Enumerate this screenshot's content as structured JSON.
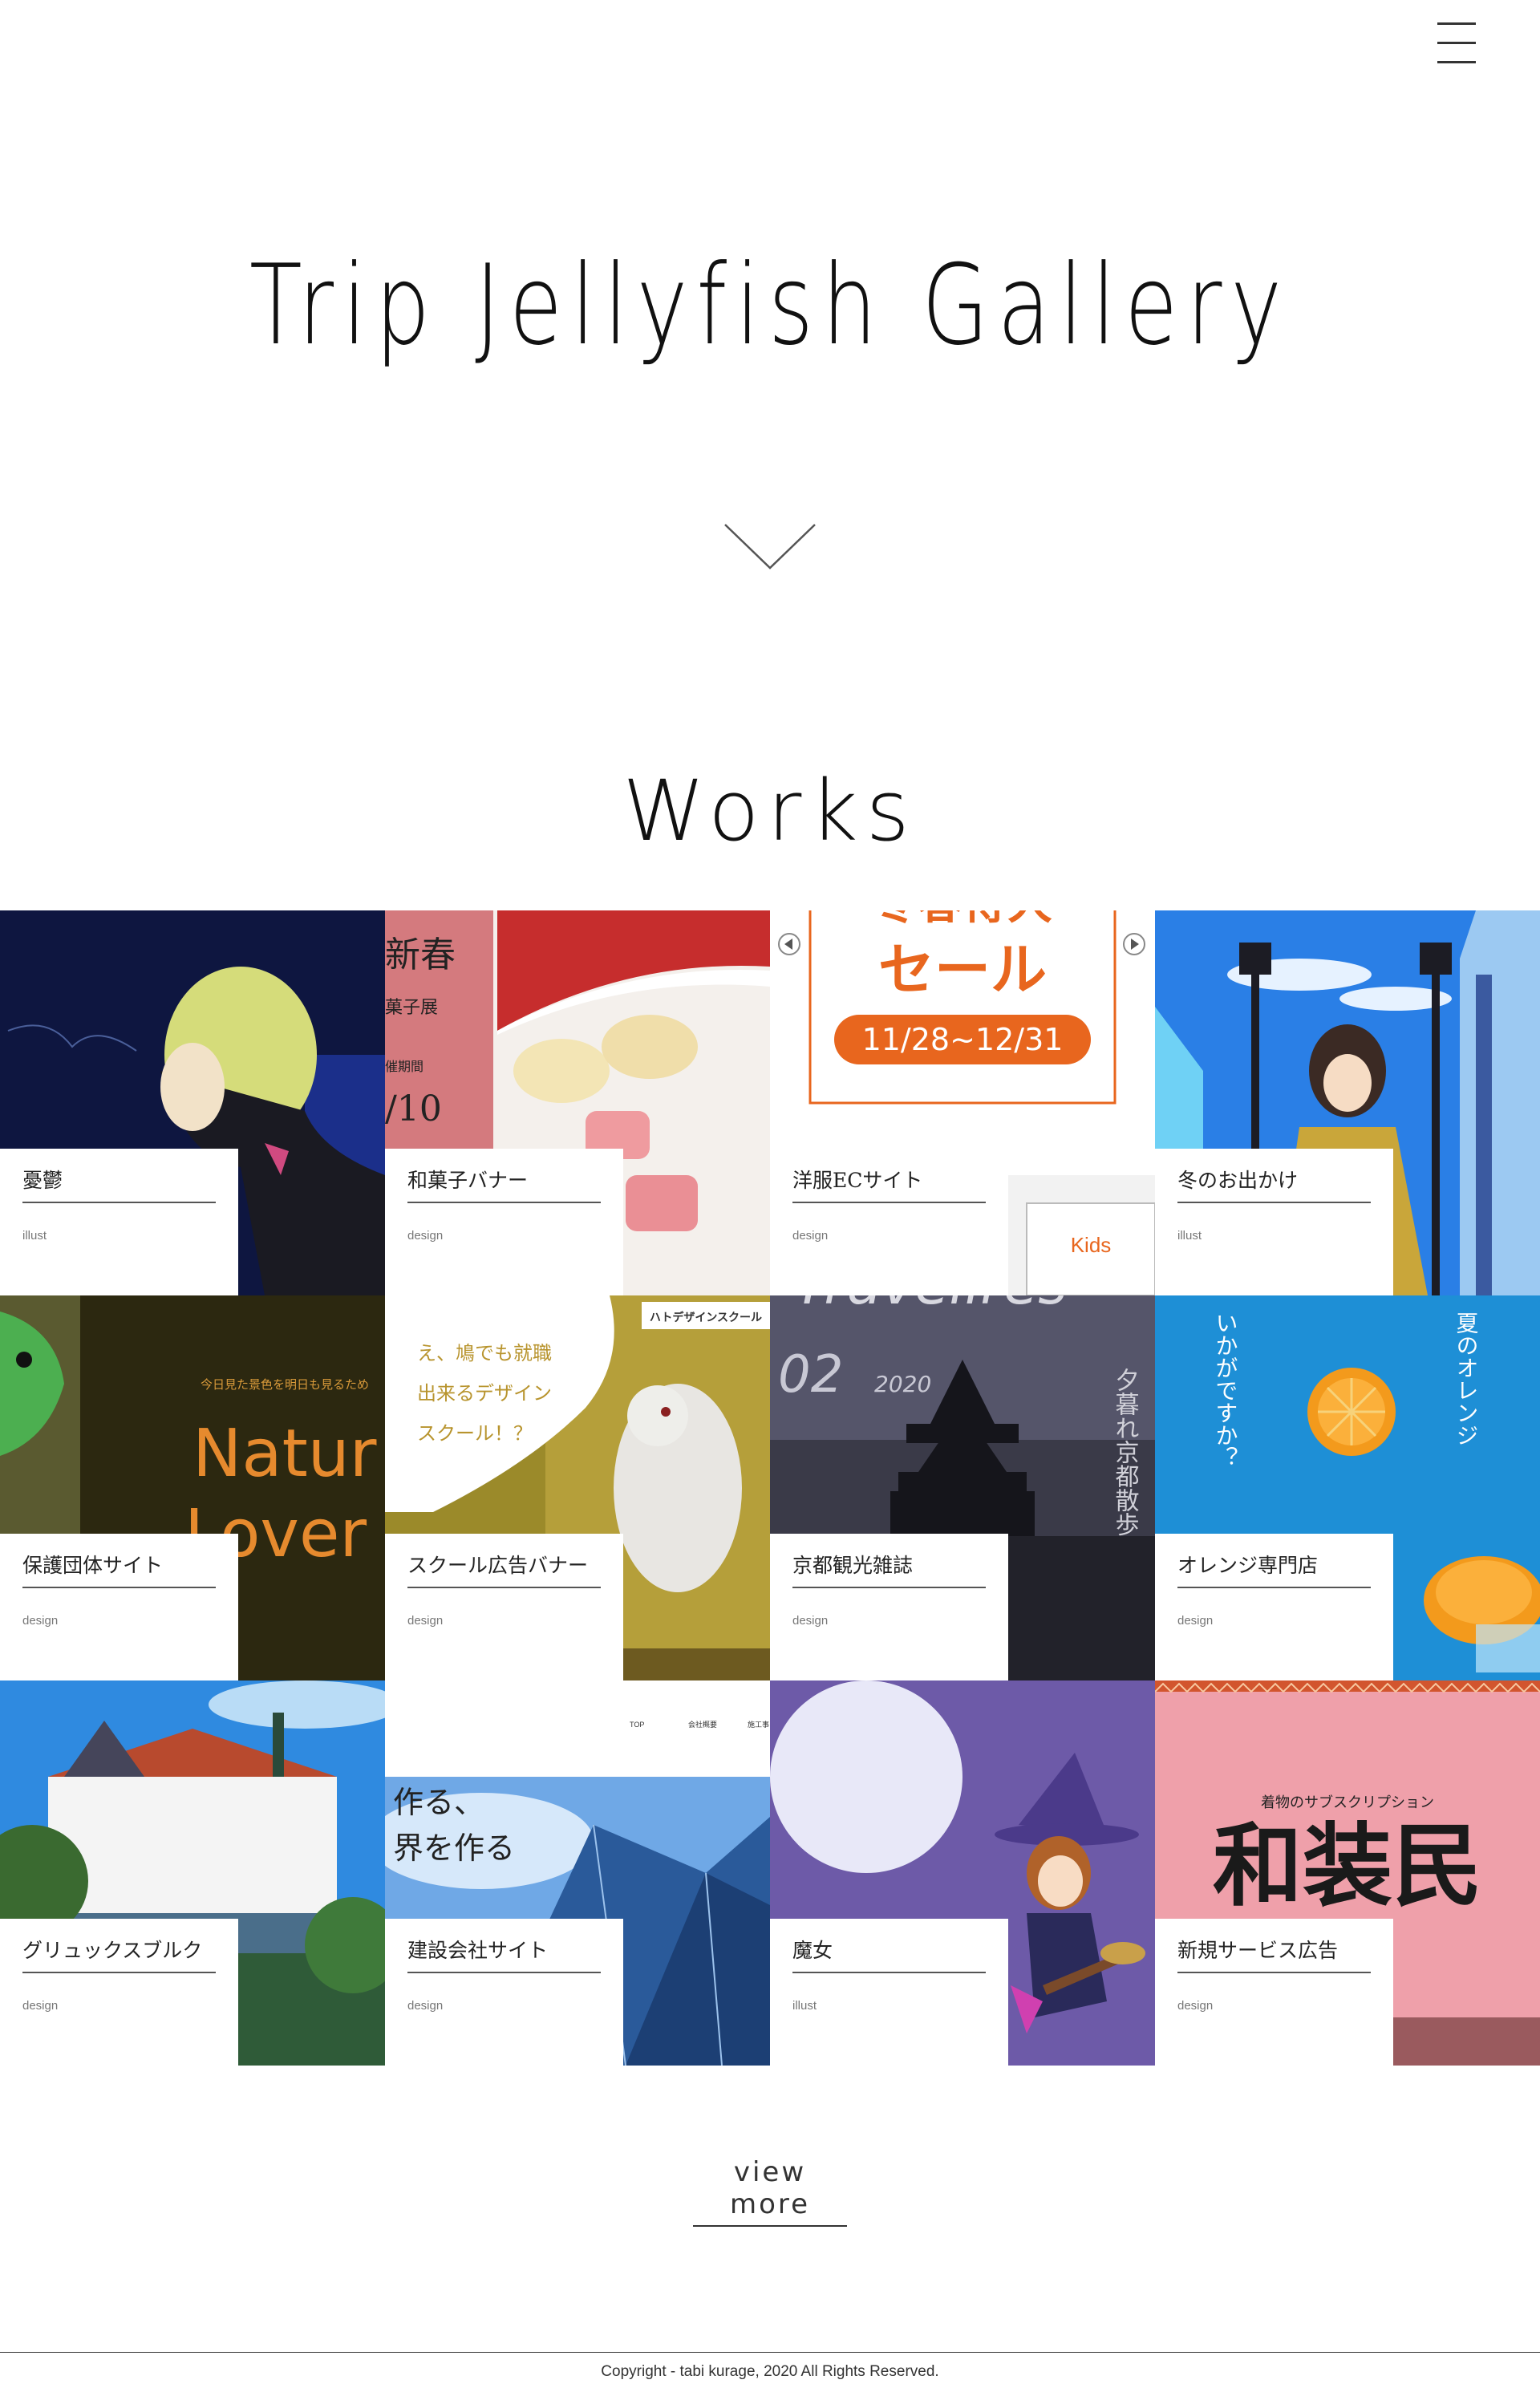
{
  "header": {
    "menu_icon": "hamburger-menu-icon"
  },
  "hero": {
    "title": "Trip Jellyfish Gallery",
    "arrow_icon": "chevron-down-icon"
  },
  "works": {
    "heading": "Works",
    "items": [
      {
        "title": "憂鬱",
        "category": "illust"
      },
      {
        "title": "和菓子バナー",
        "category": "design",
        "thumb_text": [
          "新春",
          "菓子展",
          "催期間",
          "/10"
        ]
      },
      {
        "title": "洋服ECサイト",
        "category": "design",
        "thumb_text": [
          "冬春得大",
          "セール",
          "11/28~12/31",
          "Kids"
        ]
      },
      {
        "title": "冬のお出かけ",
        "category": "illust"
      },
      {
        "title": "保護団体サイト",
        "category": "design",
        "thumb_text": [
          "今日見た景色を明日も見るため",
          "Natur",
          "Lover"
        ]
      },
      {
        "title": "スクール広告バナー",
        "category": "design",
        "thumb_text": [
          "え、鳩でも就職",
          "出来るデザイン",
          "スクール！？",
          "ハトデザインスクール"
        ]
      },
      {
        "title": "京都観光雑誌",
        "category": "design",
        "thumb_text": [
          "Travellres",
          "02",
          "2020",
          "夕暮れ京都散歩"
        ]
      },
      {
        "title": "オレンジ専門店",
        "category": "design",
        "thumb_text": [
          "いかがですか？",
          "夏のオレンジ"
        ]
      },
      {
        "title": "グリュックスブルク",
        "category": "design"
      },
      {
        "title": "建設会社サイト",
        "category": "design",
        "thumb_text": [
          "作る、",
          "界を作る",
          "TOP",
          "会社概要",
          "施工事"
        ]
      },
      {
        "title": "魔女",
        "category": "illust"
      },
      {
        "title": "新規サービス広告",
        "category": "design",
        "thumb_text": [
          "着物のサブスクリプション",
          "和装民"
        ]
      }
    ]
  },
  "view_more": "view more",
  "footer": {
    "copyright": "Copyright - tabi kurage, 2020 All Rights Reserved."
  }
}
